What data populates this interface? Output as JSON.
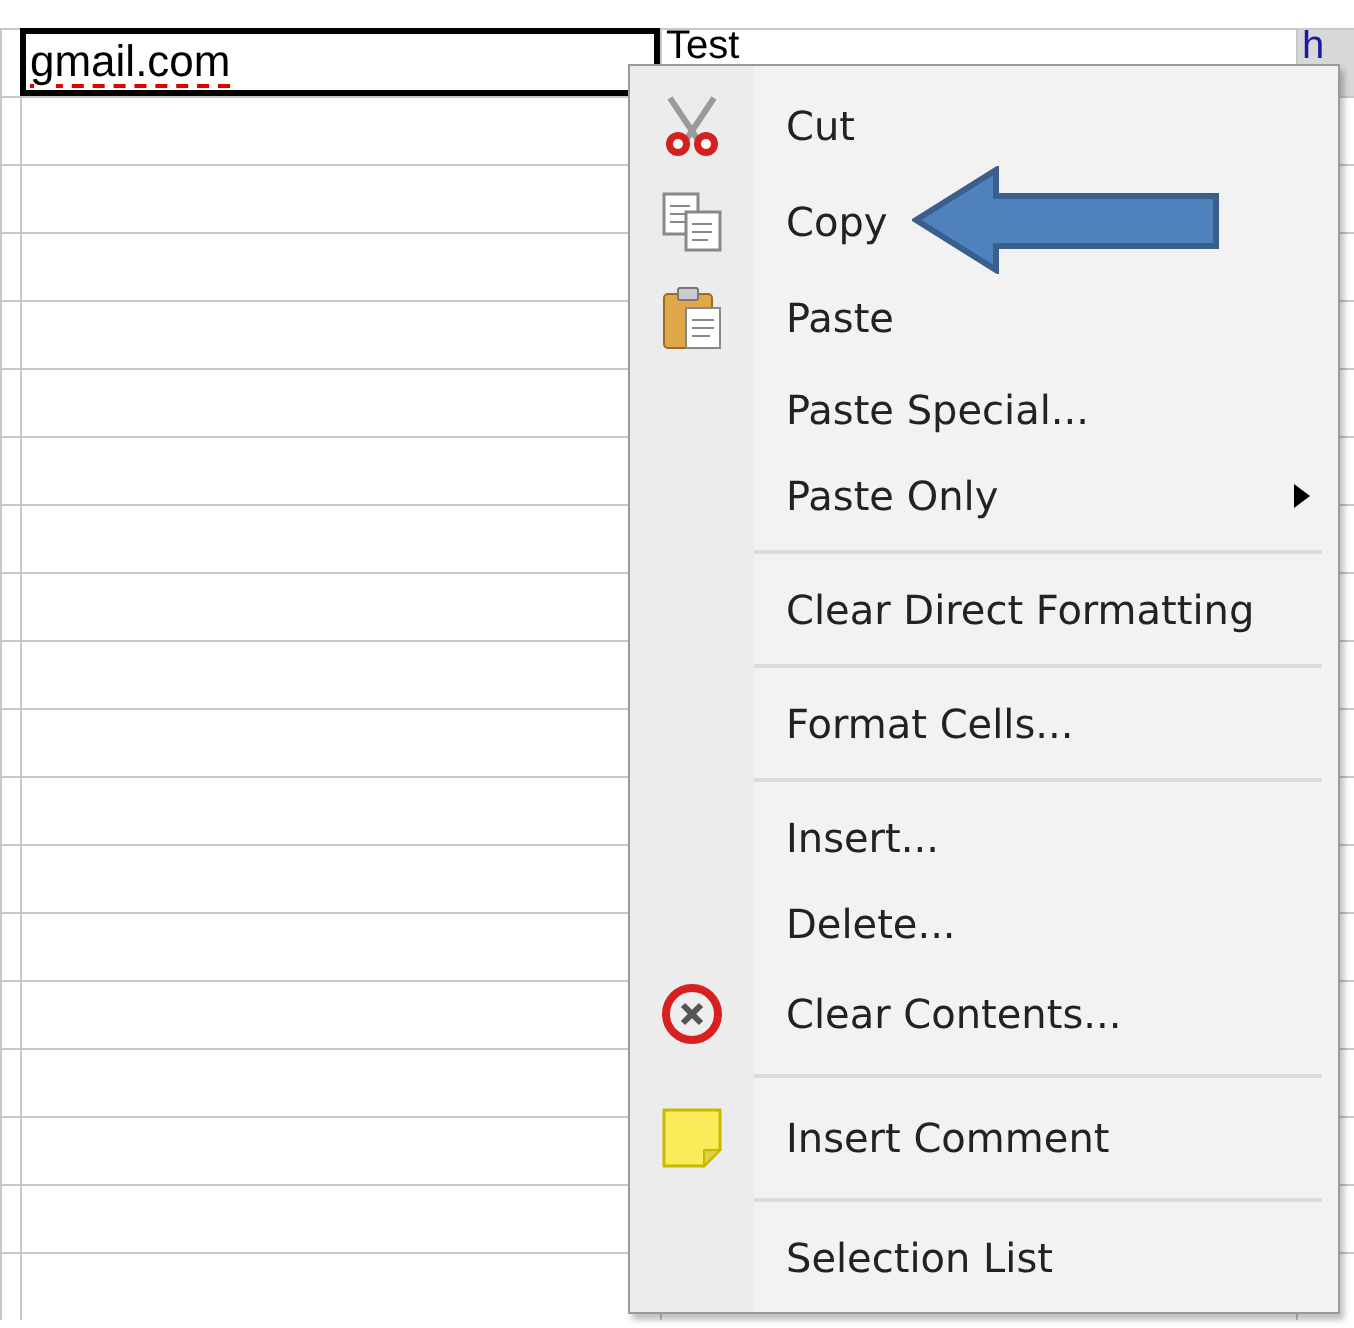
{
  "sheet": {
    "cells": [
      {
        "text": "gmail.com",
        "kind": "text",
        "selected": true,
        "misspelled": true
      },
      {
        "text": "Test",
        "kind": "text",
        "selected": false
      },
      {
        "text": "h",
        "kind": "link",
        "selected": false
      }
    ]
  },
  "context_menu": {
    "items": [
      {
        "kind": "cut",
        "label": "Cut"
      },
      {
        "kind": "copy",
        "label": "Copy"
      },
      {
        "kind": "paste",
        "label": "Paste"
      },
      {
        "kind": "plain",
        "label": "Paste Special..."
      },
      {
        "kind": "plain",
        "label": "Paste Only",
        "submenu": true
      },
      {
        "kind": "separator"
      },
      {
        "kind": "plain",
        "label": "Clear Direct Formatting"
      },
      {
        "kind": "separator"
      },
      {
        "kind": "plain",
        "label": "Format Cells..."
      },
      {
        "kind": "separator"
      },
      {
        "kind": "plain",
        "label": "Insert..."
      },
      {
        "kind": "plain",
        "label": "Delete..."
      },
      {
        "kind": "clear",
        "label": "Clear Contents..."
      },
      {
        "kind": "separator"
      },
      {
        "kind": "comment",
        "label": "Insert Comment"
      },
      {
        "kind": "separator"
      },
      {
        "kind": "plain",
        "label": "Selection List"
      }
    ]
  },
  "annotation": {
    "kind": "arrow"
  }
}
